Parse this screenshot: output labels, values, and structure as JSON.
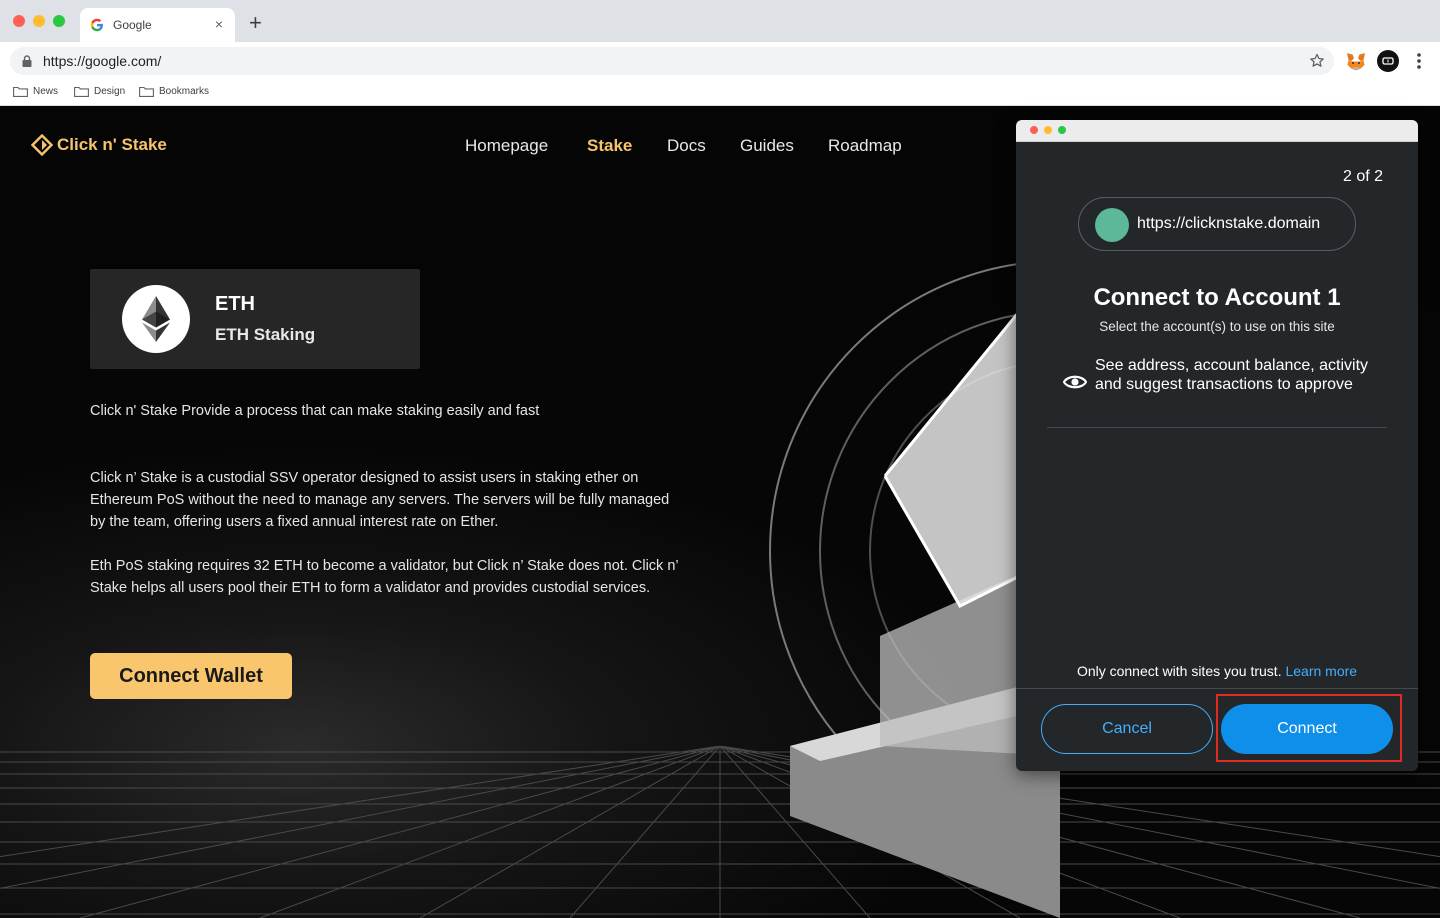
{
  "browser": {
    "tab_title": "Google",
    "tab_close": "×",
    "new_tab": "+",
    "url": "https://google.com/",
    "bookmarks": [
      "News",
      "Design",
      "Bookmarks"
    ]
  },
  "site": {
    "logo_text": "Click n' Stake",
    "nav": [
      "Homepage",
      "Stake",
      "Docs",
      "Guides",
      "Roadmap"
    ],
    "active_nav": "Stake",
    "token": {
      "symbol": "ETH",
      "name": "ETH Staking"
    },
    "tagline": "Click n' Stake Provide a process that can make staking easily and fast",
    "paragraph_1": "Click n’ Stake is a custodial SSV operator designed to assist users in staking ether on Ethereum PoS without the need to manage any servers. The servers will be fully managed by the team, offering users a fixed annual interest rate on Ether.",
    "paragraph_2": "Eth PoS staking requires 32 ETH to become a validator, but Click n’ Stake does not. Click n’ Stake helps all users pool their ETH to form a validator and provides custodial services.",
    "connect_wallet_label": "Connect Wallet"
  },
  "wallet_popup": {
    "page_count": "2 of 2",
    "site_url": "https://clicknstake.domain",
    "title": "Connect to Account 1",
    "subtitle": "Select the account(s) to use on this site",
    "permission": "See address, account balance, activity and suggest transactions to approve",
    "trust_note": "Only connect with sites you trust.",
    "learn_more": "Learn more",
    "cancel_label": "Cancel",
    "connect_label": "Connect"
  },
  "colors": {
    "accent_gold": "#f5c46b",
    "button_gold": "#f9c56d",
    "wallet_blue": "#0e8fea",
    "highlight_red": "#e02b20"
  }
}
